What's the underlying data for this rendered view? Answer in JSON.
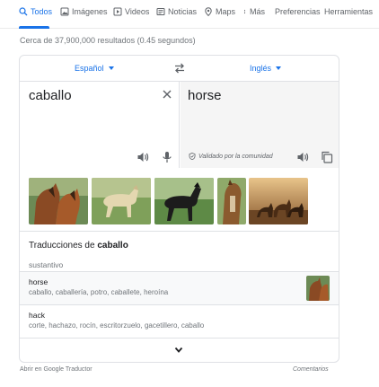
{
  "tabs": [
    {
      "label": "Todos",
      "icon": "search-icon"
    },
    {
      "label": "Imágenes",
      "icon": "image-icon"
    },
    {
      "label": "Videos",
      "icon": "video-icon"
    },
    {
      "label": "Noticias",
      "icon": "news-icon"
    },
    {
      "label": "Maps",
      "icon": "map-pin-icon"
    },
    {
      "label": "Más",
      "icon": "more-vert-icon"
    },
    {
      "label": "Preferencias"
    },
    {
      "label": "Herramientas"
    }
  ],
  "results_count": "Cerca de 37,900,000 resultados (0.45 segundos)",
  "translator": {
    "source_lang": "Español",
    "target_lang": "Inglés",
    "source_text": "caballo",
    "target_text": "horse",
    "validated_label": "Validado por la comunidad",
    "translations_prefix": "Traducciones de",
    "translations_word": "caballo",
    "part_of_speech": "sustantivo",
    "entries": [
      {
        "word": "horse",
        "synonyms": "caballo, caballería, potro, caballete, heroína"
      },
      {
        "word": "hack",
        "synonyms": "corte, hachazo, rocín, escritorzuelo, gacetillero, caballo"
      }
    ]
  },
  "footer": {
    "open_link": "Abrir en Google Traductor",
    "feedback_link": "Comentarios"
  },
  "colors": {
    "accent": "#1a73e8",
    "muted": "#70757a",
    "border": "#dfe1e5",
    "target_pane": "#f5f5f5"
  }
}
